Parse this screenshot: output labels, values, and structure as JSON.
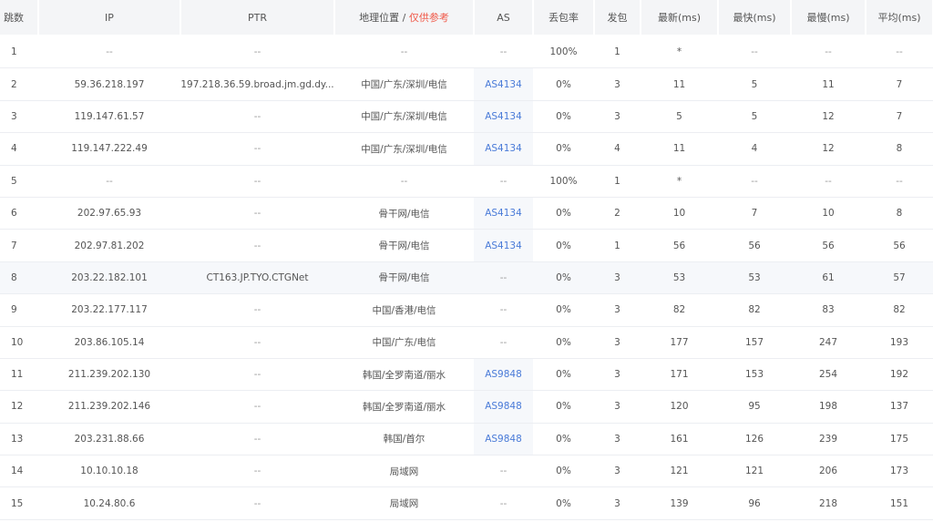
{
  "header": {
    "hop": "跳数",
    "ip": "IP",
    "ptr": "PTR",
    "geo": "地理位置",
    "geo_sep": " / ",
    "geo_note": "仅供参考",
    "as": "AS",
    "loss": "丢包率",
    "sent": "发包",
    "last": "最新(ms)",
    "best": "最快(ms)",
    "worst": "最慢(ms)",
    "avg": "平均(ms)"
  },
  "colors": {
    "as_link": "#4a7bd8",
    "note": "#f05a4a",
    "highlight_row": "#f6f8fb"
  },
  "highlighted_row": 8,
  "rows": [
    {
      "hop": "1",
      "ip": "--",
      "ptr": "--",
      "geo": "--",
      "as": "--",
      "loss": "100%",
      "sent": "1",
      "last": "*",
      "best": "--",
      "worst": "--",
      "avg": "--"
    },
    {
      "hop": "2",
      "ip": "59.36.218.197",
      "ptr": "197.218.36.59.broad.jm.gd.dy...",
      "geo": "中国/广东/深圳/电信",
      "as": "AS4134",
      "loss": "0%",
      "sent": "3",
      "last": "11",
      "best": "5",
      "worst": "11",
      "avg": "7"
    },
    {
      "hop": "3",
      "ip": "119.147.61.57",
      "ptr": "--",
      "geo": "中国/广东/深圳/电信",
      "as": "AS4134",
      "loss": "0%",
      "sent": "3",
      "last": "5",
      "best": "5",
      "worst": "12",
      "avg": "7"
    },
    {
      "hop": "4",
      "ip": "119.147.222.49",
      "ptr": "--",
      "geo": "中国/广东/深圳/电信",
      "as": "AS4134",
      "loss": "0%",
      "sent": "4",
      "last": "11",
      "best": "4",
      "worst": "12",
      "avg": "8"
    },
    {
      "hop": "5",
      "ip": "--",
      "ptr": "--",
      "geo": "--",
      "as": "--",
      "loss": "100%",
      "sent": "1",
      "last": "*",
      "best": "--",
      "worst": "--",
      "avg": "--"
    },
    {
      "hop": "6",
      "ip": "202.97.65.93",
      "ptr": "--",
      "geo": "骨干网/电信",
      "as": "AS4134",
      "loss": "0%",
      "sent": "2",
      "last": "10",
      "best": "7",
      "worst": "10",
      "avg": "8"
    },
    {
      "hop": "7",
      "ip": "202.97.81.202",
      "ptr": "--",
      "geo": "骨干网/电信",
      "as": "AS4134",
      "loss": "0%",
      "sent": "1",
      "last": "56",
      "best": "56",
      "worst": "56",
      "avg": "56"
    },
    {
      "hop": "8",
      "ip": "203.22.182.101",
      "ptr": "CT163.JP.TYO.CTGNet",
      "geo": "骨干网/电信",
      "as": "--",
      "loss": "0%",
      "sent": "3",
      "last": "53",
      "best": "53",
      "worst": "61",
      "avg": "57"
    },
    {
      "hop": "9",
      "ip": "203.22.177.117",
      "ptr": "--",
      "geo": "中国/香港/电信",
      "as": "--",
      "loss": "0%",
      "sent": "3",
      "last": "82",
      "best": "82",
      "worst": "83",
      "avg": "82"
    },
    {
      "hop": "10",
      "ip": "203.86.105.14",
      "ptr": "--",
      "geo": "中国/广东/电信",
      "as": "--",
      "loss": "0%",
      "sent": "3",
      "last": "177",
      "best": "157",
      "worst": "247",
      "avg": "193"
    },
    {
      "hop": "11",
      "ip": "211.239.202.130",
      "ptr": "--",
      "geo": "韩国/全罗南道/丽水",
      "as": "AS9848",
      "loss": "0%",
      "sent": "3",
      "last": "171",
      "best": "153",
      "worst": "254",
      "avg": "192"
    },
    {
      "hop": "12",
      "ip": "211.239.202.146",
      "ptr": "--",
      "geo": "韩国/全罗南道/丽水",
      "as": "AS9848",
      "loss": "0%",
      "sent": "3",
      "last": "120",
      "best": "95",
      "worst": "198",
      "avg": "137"
    },
    {
      "hop": "13",
      "ip": "203.231.88.66",
      "ptr": "--",
      "geo": "韩国/首尔",
      "as": "AS9848",
      "loss": "0%",
      "sent": "3",
      "last": "161",
      "best": "126",
      "worst": "239",
      "avg": "175"
    },
    {
      "hop": "14",
      "ip": "10.10.10.18",
      "ptr": "--",
      "geo": "局域网",
      "as": "--",
      "loss": "0%",
      "sent": "3",
      "last": "121",
      "best": "121",
      "worst": "206",
      "avg": "173"
    },
    {
      "hop": "15",
      "ip": "10.24.80.6",
      "ptr": "--",
      "geo": "局域网",
      "as": "--",
      "loss": "0%",
      "sent": "3",
      "last": "139",
      "best": "96",
      "worst": "218",
      "avg": "151"
    }
  ]
}
